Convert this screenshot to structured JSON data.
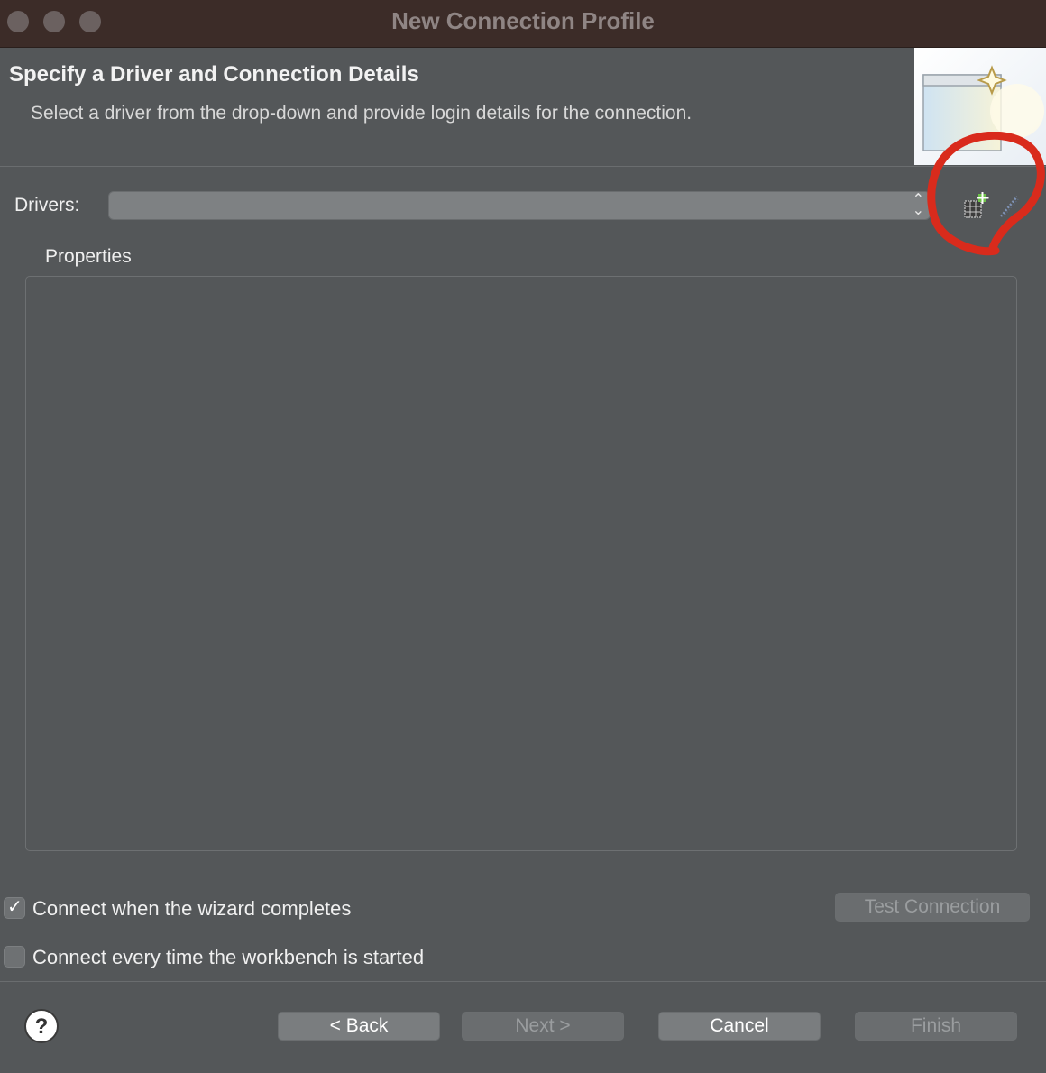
{
  "window": {
    "title": "New Connection Profile"
  },
  "header": {
    "title": "Specify a Driver and Connection Details",
    "description": "Select a driver from the drop-down and provide login details for the connection."
  },
  "drivers": {
    "label": "Drivers:",
    "selected_value": ""
  },
  "properties": {
    "label": "Properties"
  },
  "options": {
    "connect_on_complete": {
      "label": "Connect when the wizard completes",
      "checked": true
    },
    "connect_on_startup": {
      "label": "Connect every time the workbench is started",
      "checked": false
    }
  },
  "buttons": {
    "test_connection": "Test Connection",
    "back": "< Back",
    "next": "Next >",
    "cancel": "Cancel",
    "finish": "Finish"
  },
  "icons": {
    "new_driver": "new-driver-icon",
    "edit_driver": "edit-driver-icon",
    "help": "help-icon",
    "banner": "connection-wizard-banner"
  },
  "colors": {
    "background": "#545759",
    "titlebar": "#3c2c28",
    "annotation": "#d92b1c"
  }
}
